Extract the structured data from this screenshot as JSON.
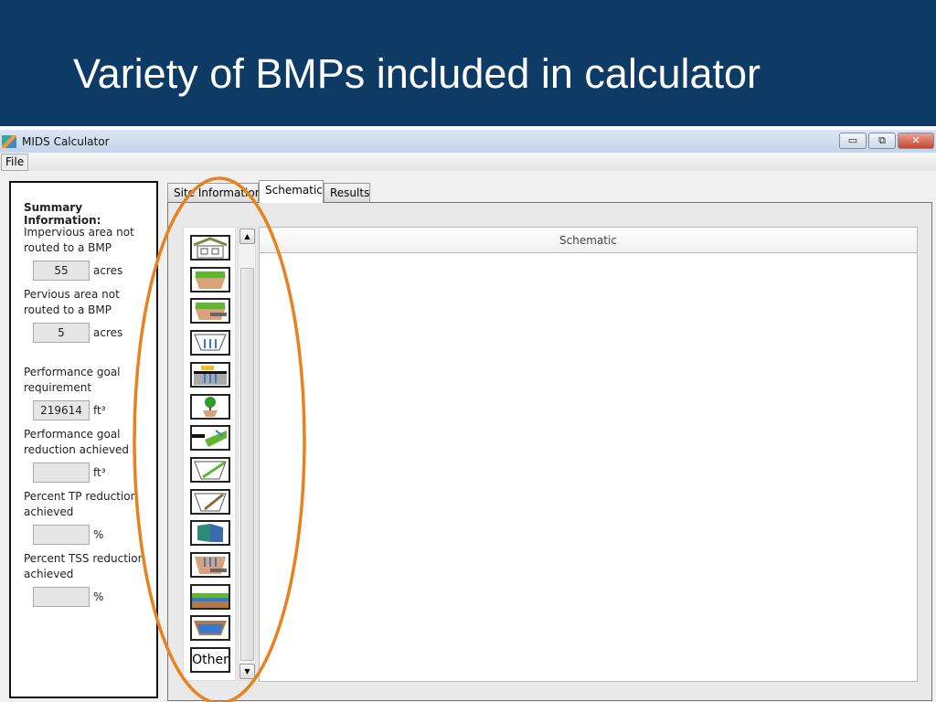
{
  "slide": {
    "title": "Variety of BMPs included in calculator"
  },
  "window": {
    "title": "MIDS Calculator",
    "minimize": "▭",
    "restore": "⧉",
    "close": "✕"
  },
  "menu": {
    "file": "File"
  },
  "summary": {
    "heading": "Summary Information:",
    "fields": [
      {
        "label": "Impervious area not routed to a BMP",
        "value": "55",
        "unit": "acres"
      },
      {
        "label": "Pervious area not routed to a BMP",
        "value": "5",
        "unit": "acres"
      },
      {
        "label": "Performance goal requirement",
        "value": "219614",
        "unit": "ft³"
      },
      {
        "label": "Performance goal reduction achieved",
        "value": "",
        "unit": "ft³"
      },
      {
        "label": "Percent TP reduction achieved",
        "value": "",
        "unit": "%"
      },
      {
        "label": "Percent TSS reduction achieved",
        "value": "",
        "unit": "%"
      }
    ]
  },
  "tabs": [
    {
      "label": "Site Information"
    },
    {
      "label": "Schematic",
      "selected": true
    },
    {
      "label": "Results"
    }
  ],
  "bmp_icons": [
    "green-roof",
    "bioretention",
    "bioretention-underdrain",
    "infiltration-basin",
    "permeable-pavement",
    "tree-trench",
    "swale-side-slope",
    "filter-strip",
    "sand-filter",
    "wet-pond",
    "infiltration-trench",
    "wetland",
    "swale",
    "other"
  ],
  "bmp_other_label": "Other",
  "schematic": {
    "header": "Schematic"
  },
  "colors": {
    "slide_header": "#0e3a66",
    "highlight_ellipse": "#e8821e"
  }
}
